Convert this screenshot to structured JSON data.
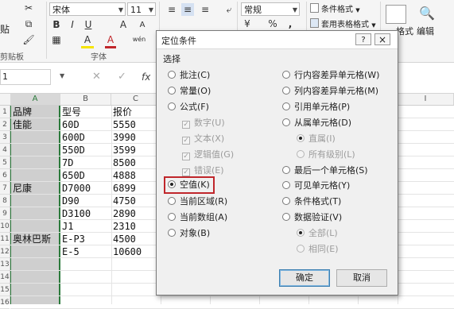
{
  "ribbon": {
    "clipboard": {
      "paste_label": "贴",
      "group_label": "剪贴板"
    },
    "font": {
      "name": "宋体",
      "size": "11",
      "bold": "B",
      "italic": "I",
      "underline": "U",
      "grow": "A",
      "shrink": "A",
      "font_color_label": "A",
      "fill_label": "A",
      "wen_label": "wén",
      "group_label": "字体"
    },
    "number": {
      "format": "常规",
      "percent": "%",
      "comma": ","
    },
    "styles": {
      "conditional": "条件格式",
      "table": "套用表格格式"
    },
    "cells": {
      "format_label": "格式",
      "edit_label": "编辑"
    }
  },
  "formula_bar": {
    "name_box": "1",
    "fx": "fx"
  },
  "columns": [
    "A",
    "B",
    "C",
    "I"
  ],
  "rows": [
    "1",
    "2",
    "3",
    "4",
    "5",
    "6",
    "7",
    "8",
    "9",
    "10",
    "11",
    "12",
    "13",
    "14",
    "15",
    "16"
  ],
  "cells": {
    "headers": [
      "品牌",
      "型号",
      "报价"
    ],
    "brands": [
      {
        "row": 2,
        "text": "佳能"
      },
      {
        "row": 7,
        "text": "尼康"
      },
      {
        "row": 11,
        "text": "奥林巴斯"
      }
    ],
    "models": [
      "60D",
      "600D",
      "550D",
      "7D",
      "650D",
      "D7000",
      "D90",
      "D3100",
      "J1",
      "E-P3",
      "E-5"
    ],
    "prices": [
      "5550",
      "3990",
      "3599",
      "8500",
      "4888",
      "6899",
      "4750",
      "2890",
      "2310",
      "4500",
      "10600"
    ]
  },
  "dialog": {
    "title": "定位条件",
    "help": "?",
    "close": "×",
    "section_label": "选择",
    "left_options": [
      {
        "label": "批注(C)",
        "checked": false
      },
      {
        "label": "常量(O)",
        "checked": false
      },
      {
        "label": "公式(F)",
        "checked": false
      }
    ],
    "formula_subs": [
      "数字(U)",
      "文本(X)",
      "逻辑值(G)",
      "错误(E)"
    ],
    "left_options_2": [
      {
        "label": "空值(K)",
        "checked": true
      },
      {
        "label": "当前区域(R)",
        "checked": false
      },
      {
        "label": "当前数组(A)",
        "checked": false
      },
      {
        "label": "对象(B)",
        "checked": false
      }
    ],
    "right_options": [
      {
        "label": "行内容差异单元格(W)"
      },
      {
        "label": "列内容差异单元格(M)"
      },
      {
        "label": "引用单元格(P)"
      },
      {
        "label": "从属单元格(D)"
      }
    ],
    "dependent_subs": [
      "直属(I)",
      "所有级别(L)"
    ],
    "right_options_2": [
      {
        "label": "最后一个单元格(S)"
      },
      {
        "label": "可见单元格(Y)"
      },
      {
        "label": "条件格式(T)"
      },
      {
        "label": "数据验证(V)"
      }
    ],
    "validation_subs": [
      "全部(L)",
      "相同(E)"
    ],
    "ok": "确定",
    "cancel": "取消"
  },
  "colors": {
    "highlight_red": "#c0262b",
    "selection_green": "#2b7a3b",
    "selection_fill": "#cfcfcf"
  }
}
